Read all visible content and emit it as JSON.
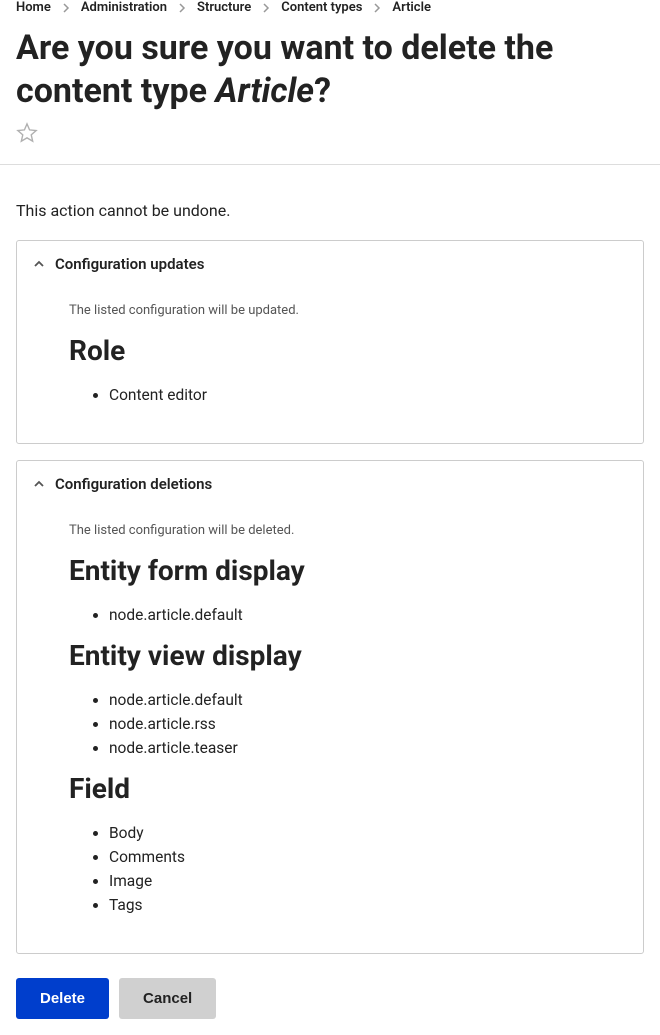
{
  "breadcrumb": {
    "items": [
      {
        "label": "Home"
      },
      {
        "label": "Administration"
      },
      {
        "label": "Structure"
      },
      {
        "label": "Content types"
      },
      {
        "label": "Article"
      }
    ]
  },
  "title": {
    "prefix": "Are you sure you want to delete the content type ",
    "emphasized": "Article",
    "suffix": "?"
  },
  "warning": "This action cannot be undone.",
  "panels": {
    "updates": {
      "title": "Configuration updates",
      "desc": "The listed configuration will be updated.",
      "sections": [
        {
          "heading": "Role",
          "items": [
            "Content editor"
          ]
        }
      ]
    },
    "deletions": {
      "title": "Configuration deletions",
      "desc": "The listed configuration will be deleted.",
      "sections": [
        {
          "heading": "Entity form display",
          "items": [
            "node.article.default"
          ]
        },
        {
          "heading": "Entity view display",
          "items": [
            "node.article.default",
            "node.article.rss",
            "node.article.teaser"
          ]
        },
        {
          "heading": "Field",
          "items": [
            "Body",
            "Comments",
            "Image",
            "Tags"
          ]
        }
      ]
    }
  },
  "actions": {
    "delete": "Delete",
    "cancel": "Cancel"
  }
}
